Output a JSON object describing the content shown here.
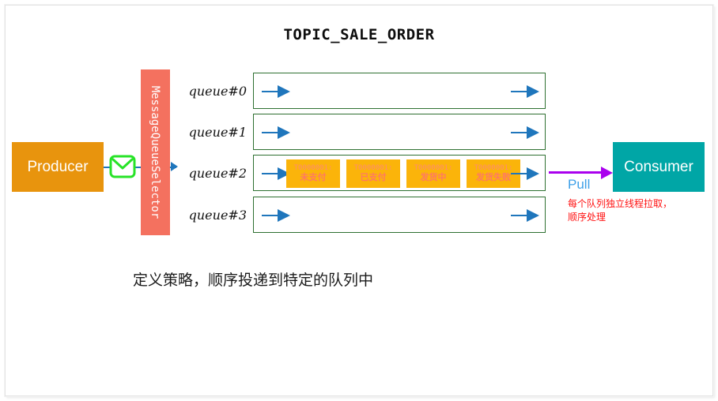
{
  "diagram": {
    "title": "TOPIC_SALE_ORDER",
    "producer": {
      "label": "Producer",
      "color": "#e8940d"
    },
    "consumer": {
      "label": "Consumer",
      "color": "#00a6a6"
    },
    "selector": {
      "label": "MessageQueueSelector",
      "color": "#f4715f"
    },
    "envelope_icon": "envelope-icon",
    "queues": [
      {
        "label": "queue#0",
        "messages": []
      },
      {
        "label": "queue#1",
        "messages": []
      },
      {
        "label": "queue#2",
        "messages": [
          {
            "id": "T0000001:",
            "status": "未支付"
          },
          {
            "id": "T0000001:",
            "status": "已支付"
          },
          {
            "id": "T0000001:",
            "status": "发货中"
          },
          {
            "id": "T0000001:",
            "status": "发货失败"
          }
        ]
      },
      {
        "label": "queue#3",
        "messages": []
      }
    ],
    "pull": {
      "label": "Pull",
      "color": "#aa00ee",
      "label_color": "#3ea0e8"
    },
    "note_red": {
      "line1": "每个队列独立线程拉取，",
      "line2": "顺序处理",
      "color": "#ff1111"
    },
    "caption": "定义策略，顺序投递到特定的队列中",
    "queue_border_color": "#2e7031",
    "queue_arrow_color": "#1f76bc",
    "message_color": "#fbb40a",
    "message_text_color": "#ff7a62"
  }
}
